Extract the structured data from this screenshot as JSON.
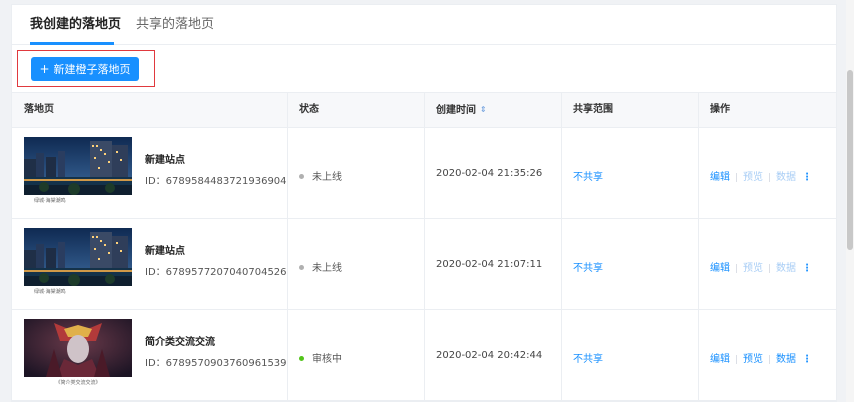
{
  "tabs": {
    "active": "我创建的落地页",
    "inactive": "共享的落地页"
  },
  "toolbar": {
    "new_button_label": "新建橙子落地页",
    "new_button_icon": "+"
  },
  "table": {
    "headers": {
      "page": "落地页",
      "status": "状态",
      "created": "创建时间",
      "share": "共享范围",
      "actions": "操作"
    },
    "sort_icon": "⇕",
    "rows": [
      {
        "name": "新建站点",
        "id": "ID：6789584483721936904",
        "caption": "绿城·海棠潮鸣",
        "status": "未上线",
        "status_color": "#b0b0b0",
        "created": "2020-02-04 21:35:26",
        "share": "不共享",
        "ops": [
          "编辑",
          "预览",
          "数据"
        ],
        "ops_enabled": [
          true,
          false,
          false
        ],
        "more": "⋮"
      },
      {
        "name": "新建站点",
        "id": "ID：6789577207040704526",
        "caption": "绿城·海棠潮鸣",
        "status": "未上线",
        "status_color": "#b0b0b0",
        "created": "2020-02-04 21:07:11",
        "share": "不共享",
        "ops": [
          "编辑",
          "预览",
          "数据"
        ],
        "ops_enabled": [
          true,
          false,
          false
        ],
        "more": "⋮"
      },
      {
        "name": "简介类交流交流",
        "id": "ID：6789570903760961539",
        "caption": "《简介类交流交流》",
        "status": "审核中",
        "status_color": "#52c41a",
        "created": "2020-02-04 20:42:44",
        "share": "不共享",
        "ops": [
          "编辑",
          "预览",
          "数据"
        ],
        "ops_enabled": [
          true,
          true,
          true
        ],
        "more": "⋮"
      }
    ]
  }
}
